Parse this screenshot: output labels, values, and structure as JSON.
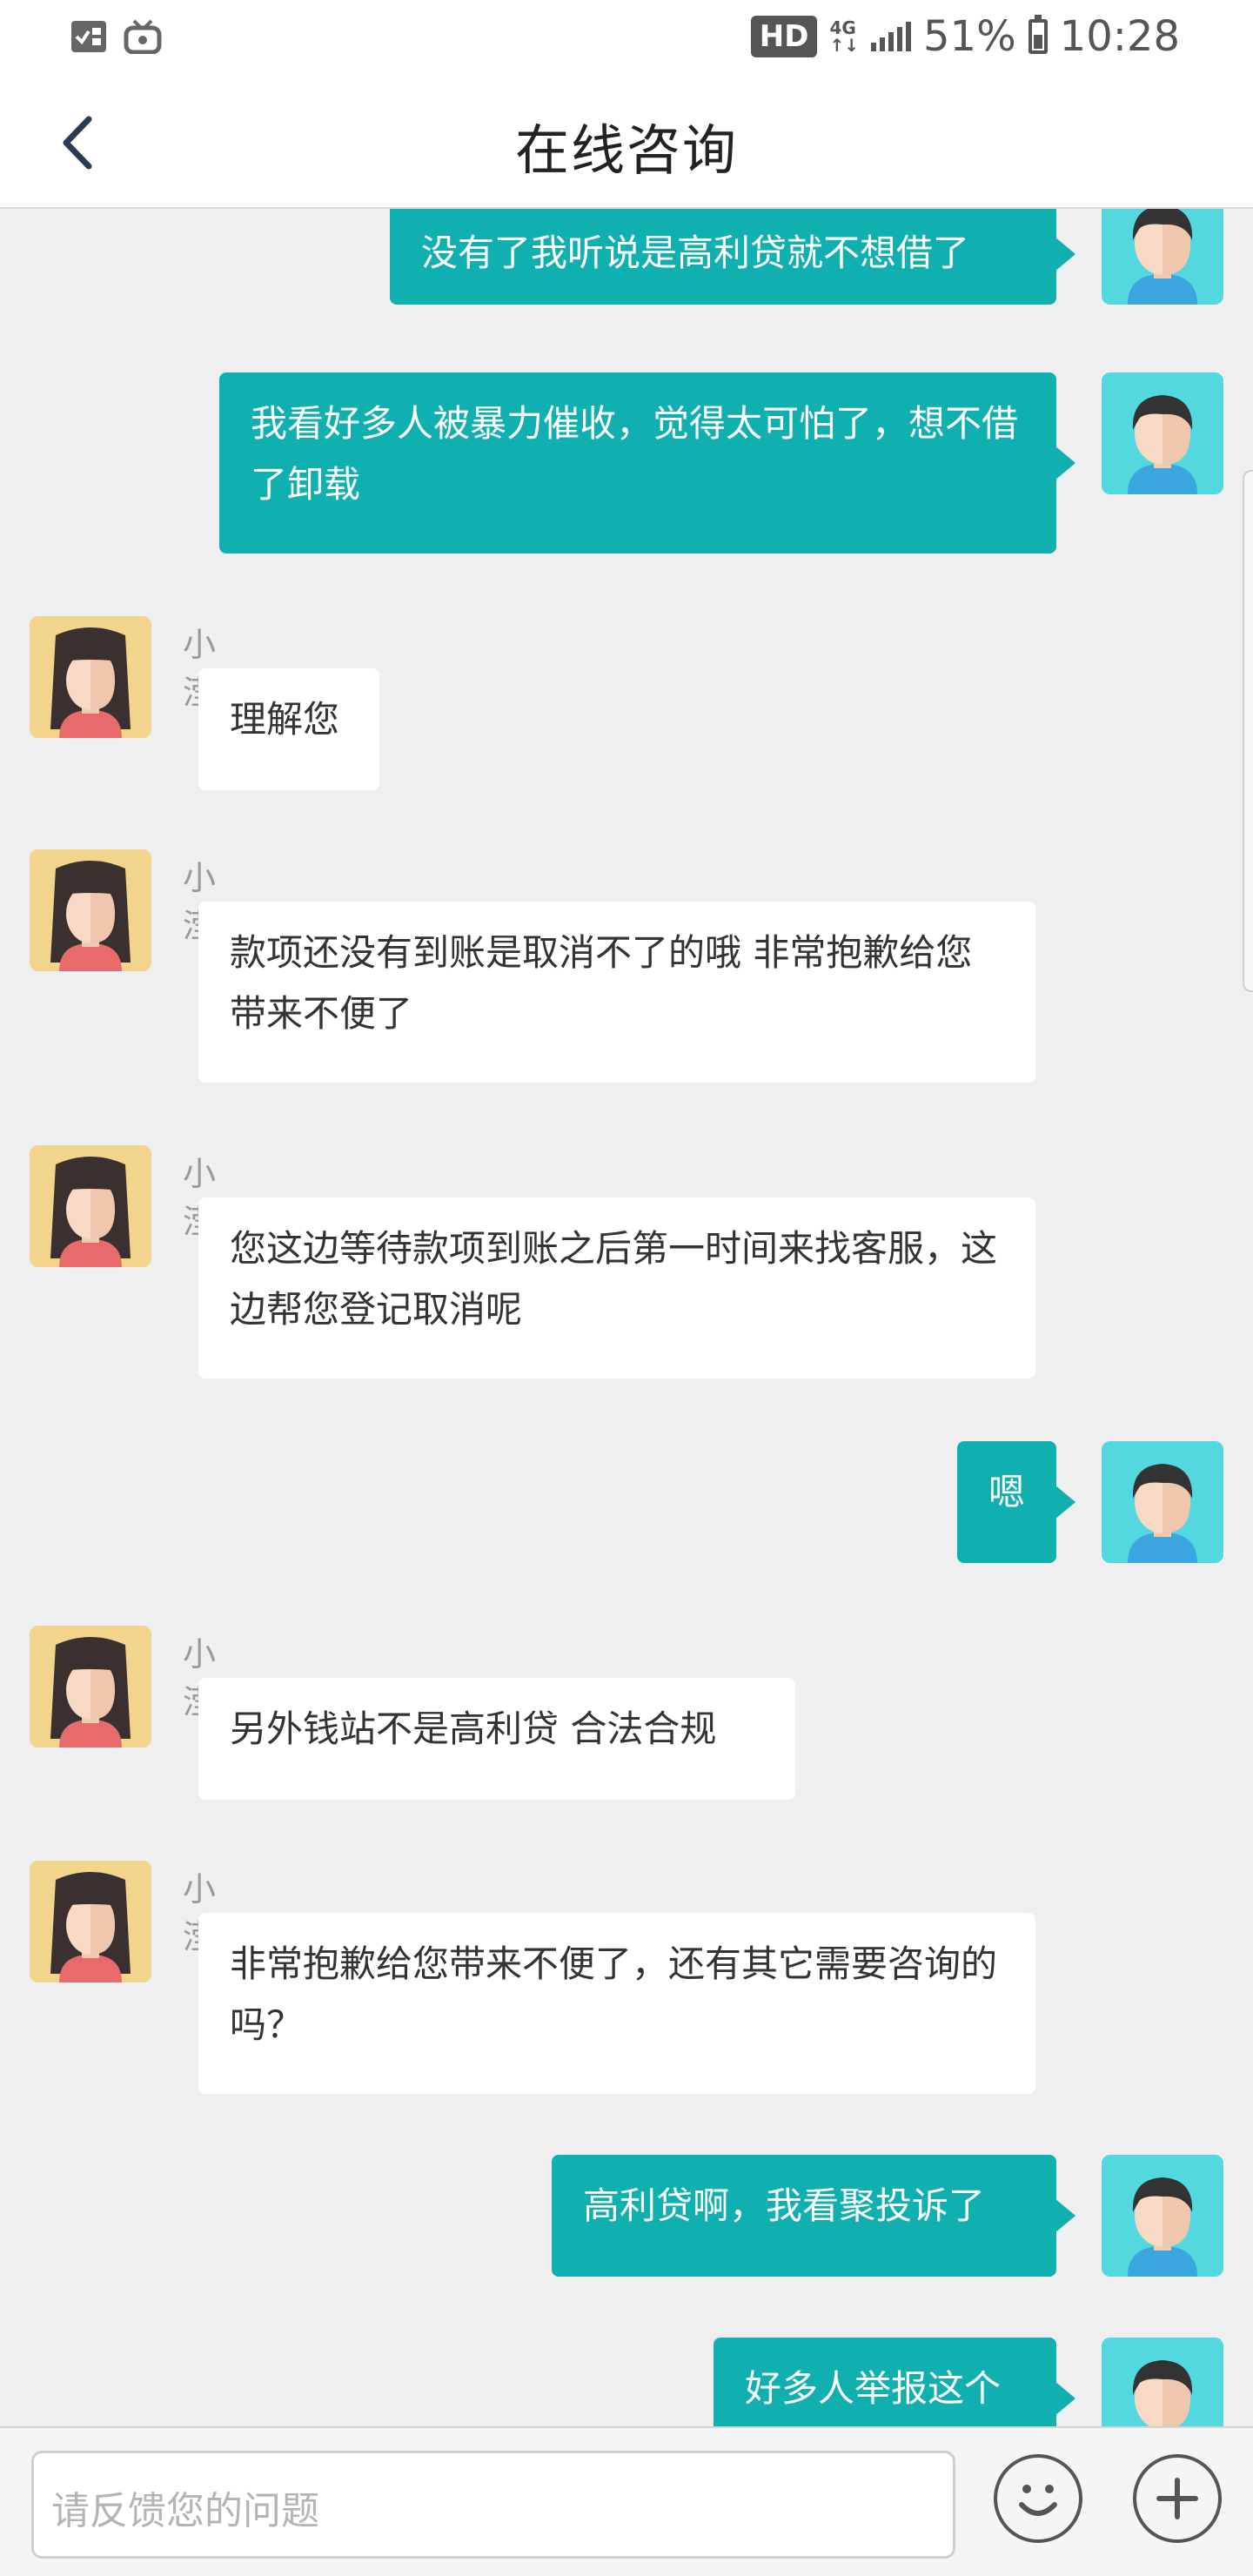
{
  "status_bar": {
    "hd": "HD",
    "network": "4G",
    "battery": "51%",
    "time": "10:28"
  },
  "header": {
    "title": "在线咨询"
  },
  "messages": [
    {
      "from": "user",
      "text": "没有了我听说是高利贷就不想借了"
    },
    {
      "from": "user",
      "text": "我看好多人被暴力催收，觉得太可怕了，想不借了卸载"
    },
    {
      "from": "agent",
      "name": "小滢",
      "text": "理解您"
    },
    {
      "from": "agent",
      "name": "小滢",
      "text": "款项还没有到账是取消不了的哦 非常抱歉给您带来不便了"
    },
    {
      "from": "agent",
      "name": "小滢",
      "text": "您这边等待款项到账之后第一时间来找客服，这边帮您登记取消呢"
    },
    {
      "from": "user",
      "text": "嗯"
    },
    {
      "from": "agent",
      "name": "小滢",
      "text": "另外钱站不是高利贷 合法合规"
    },
    {
      "from": "agent",
      "name": "小滢",
      "text": "非常抱歉给您带来不便了，还有其它需要咨询的吗？"
    },
    {
      "from": "user",
      "text": "高利贷啊，我看聚投诉了"
    },
    {
      "from": "user",
      "text": "好多人举报这个"
    }
  ],
  "input": {
    "placeholder": "请反馈您的问题"
  },
  "colors": {
    "user_bubble": "#10afb0",
    "agent_bubble": "#ffffff",
    "background": "#efefef"
  }
}
